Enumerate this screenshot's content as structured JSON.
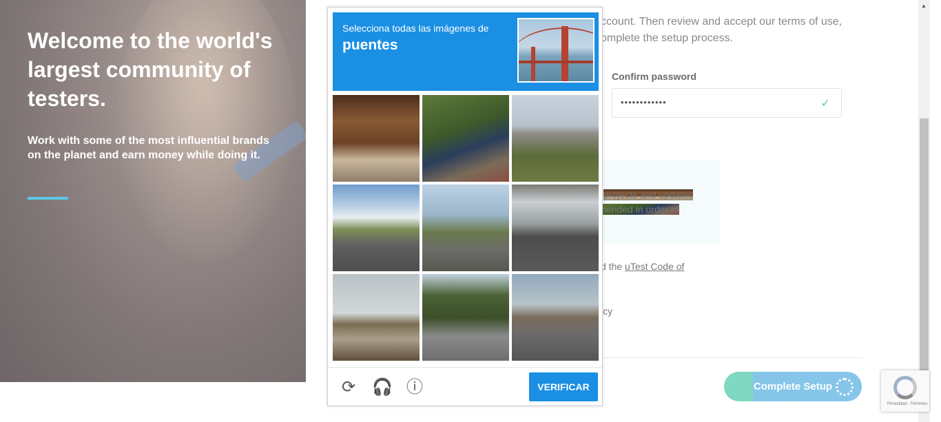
{
  "hero": {
    "title": "Welcome to the world's largest community of testers.",
    "subtitle": "Work with some of the most influential brands on the planet and earn money while doing it."
  },
  "form": {
    "intro_text": "ccount. Then review and accept our terms of use, omplete the setup process.",
    "confirm_password_label": "Confirm password",
    "confirm_password_value": "••••••••••••",
    "info_line1": "projects and updates",
    "info_line2": "hended in order to",
    "code_prefix": "d the ",
    "code_link": "uTest Code of",
    "policy_text": "icy",
    "complete_button": "Complete Setup"
  },
  "captcha": {
    "instruction_small": "Selecciona todas las imágenes de",
    "instruction_big": "puentes",
    "verify_button": "VERIFICAR",
    "tiles": [
      "tile-1",
      "tile-2",
      "tile-3",
      "tile-4",
      "tile-5",
      "tile-6",
      "tile-7",
      "tile-8",
      "tile-9"
    ]
  },
  "badge": {
    "terms": "Privacidad - Términos"
  },
  "colors": {
    "captcha_blue": "#1a8fe3",
    "accent_teal": "#7fd8c2",
    "accent_blue": "#86c6ea"
  }
}
